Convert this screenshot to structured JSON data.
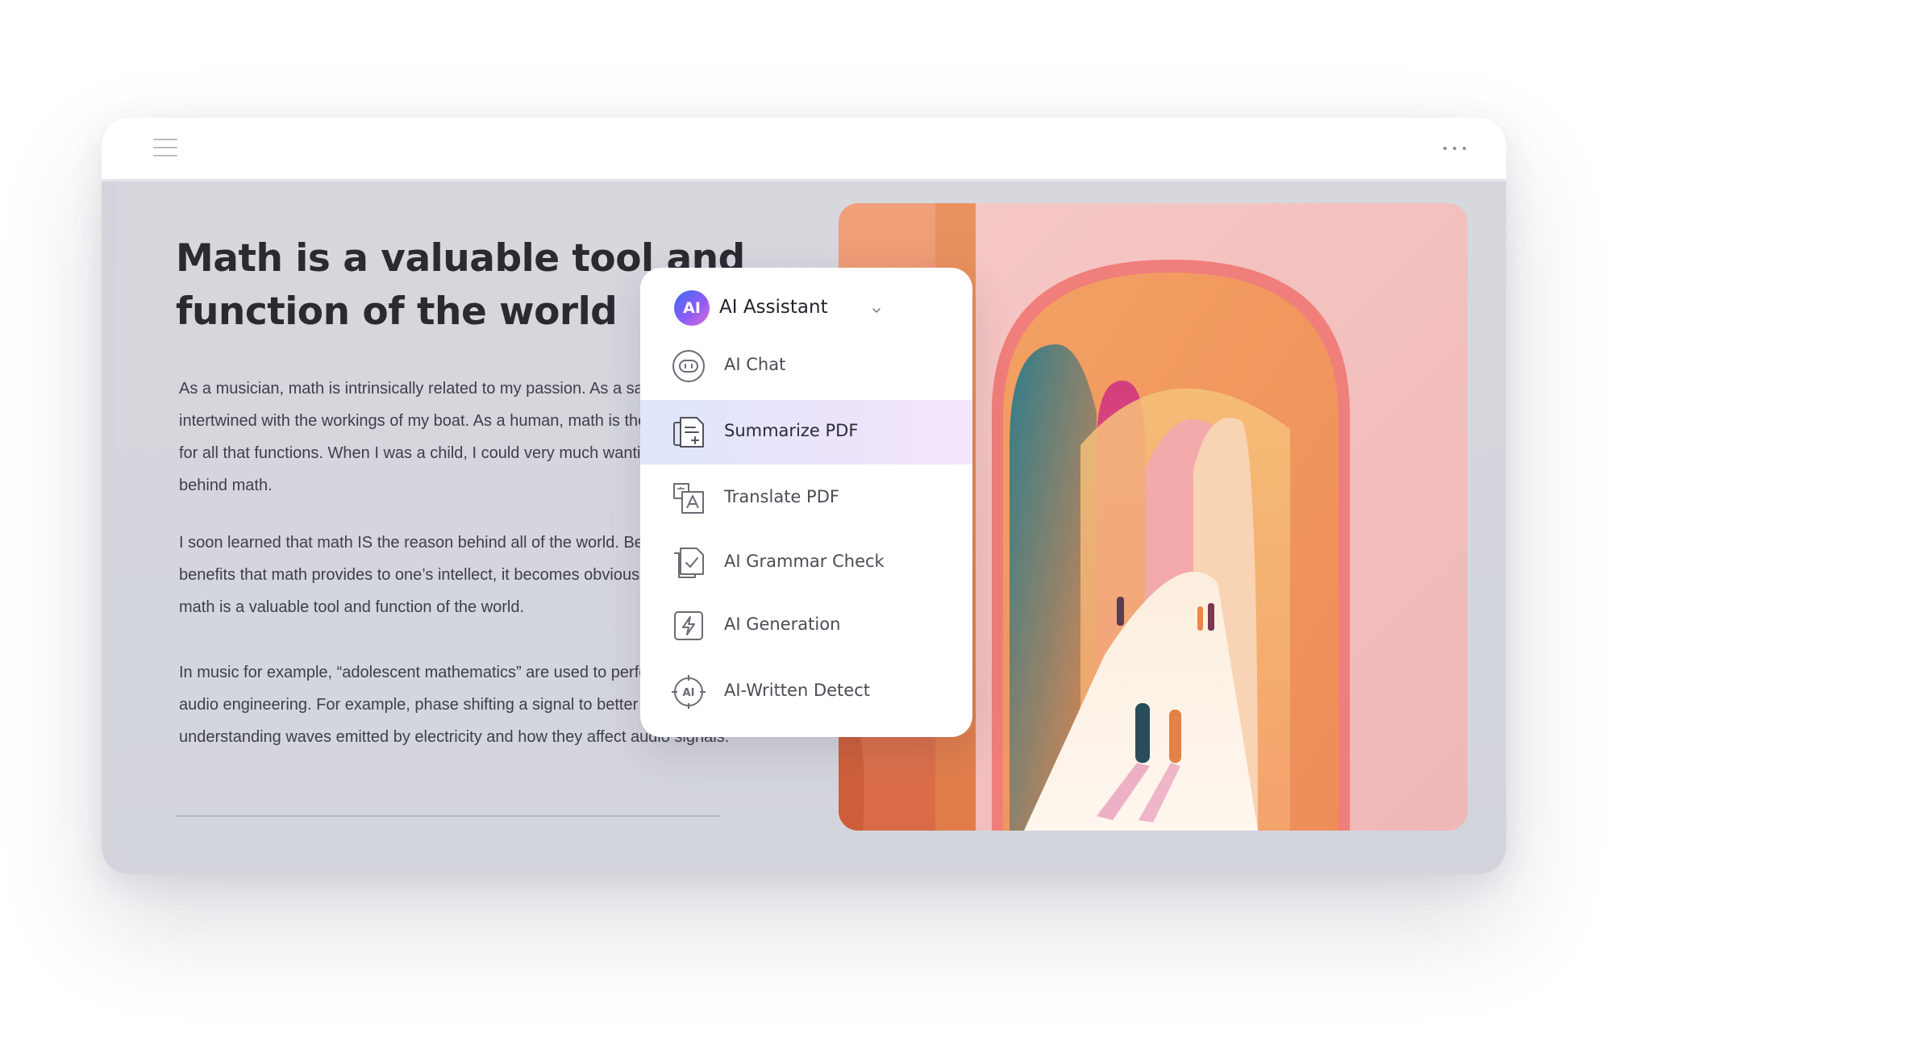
{
  "document": {
    "title": "Math is a valuable tool and function of the world",
    "paragraphs": [
      "As a musician, math is intrinsically related to my passion. As a sailor, math is intertwined with the workings of my boat. As a human, math is the building block for all that functions. When I was a child, I could very much wanting a reason behind math.",
      "I soon learned that math IS the reason behind all of the world. Besides the benefits that math provides to one’s intellect, it becomes obvious later in life that math is a valuable tool and function of the world.",
      "In music for example, “adolescent mathematics” are used to perform functions of audio engineering. For example, phase shifting a signal to better project sound or understanding waves emitted by electricity and how they affect audio signals."
    ]
  },
  "menu": {
    "badge": "AI",
    "title": "AI Assistant",
    "items": [
      {
        "label": "AI Chat",
        "icon": "robot-chat-icon"
      },
      {
        "label": "Summarize PDF",
        "icon": "summarize-document-icon",
        "active": true
      },
      {
        "label": "Translate PDF",
        "icon": "translate-icon"
      },
      {
        "label": "AI Grammar Check",
        "icon": "grammar-check-icon"
      },
      {
        "label": "AI Generation",
        "icon": "lightning-generate-icon"
      },
      {
        "label": "AI-Written Detect",
        "icon": "ai-detect-icon"
      }
    ]
  },
  "colors": {
    "accent_gradient_start": "#3d6cf5",
    "accent_gradient_end": "#e36bd6",
    "active_item_bg": "#e4e6fb"
  }
}
